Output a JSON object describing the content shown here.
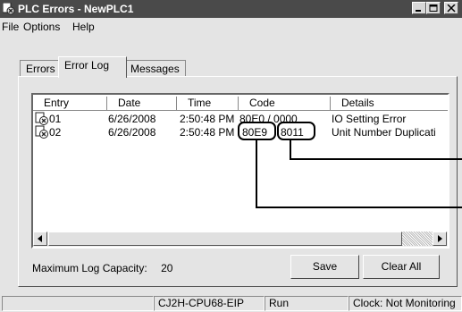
{
  "window": {
    "title": "PLC Errors - NewPLC1"
  },
  "menu": [
    "File",
    "Options",
    "Help"
  ],
  "tabs": [
    {
      "label": "Errors",
      "active": false
    },
    {
      "label": "Error Log",
      "active": true
    },
    {
      "label": "Messages",
      "active": false
    }
  ],
  "error_log": {
    "columns": [
      "Entry",
      "Date",
      "Time",
      "Code",
      "Details"
    ],
    "rows": [
      {
        "entry": "01",
        "date": "6/26/2008",
        "time": "2:50:48 PM",
        "code": "80E0 / 0000",
        "details": "IO Setting Error"
      },
      {
        "entry": "02",
        "date": "6/26/2008",
        "time": "2:50:48 PM",
        "code_part1": "80E9",
        "code_part2": "8011",
        "details": "Unit Number Duplicati"
      }
    ]
  },
  "capacity": {
    "label": "Maximum Log Capacity:",
    "value": "20"
  },
  "buttons": {
    "save": "Save",
    "clear_all": "Clear All"
  },
  "status": {
    "model": "CJ2H-CPU68-EIP",
    "mode": "Run",
    "clock": "Clock: Not Monitoring"
  }
}
